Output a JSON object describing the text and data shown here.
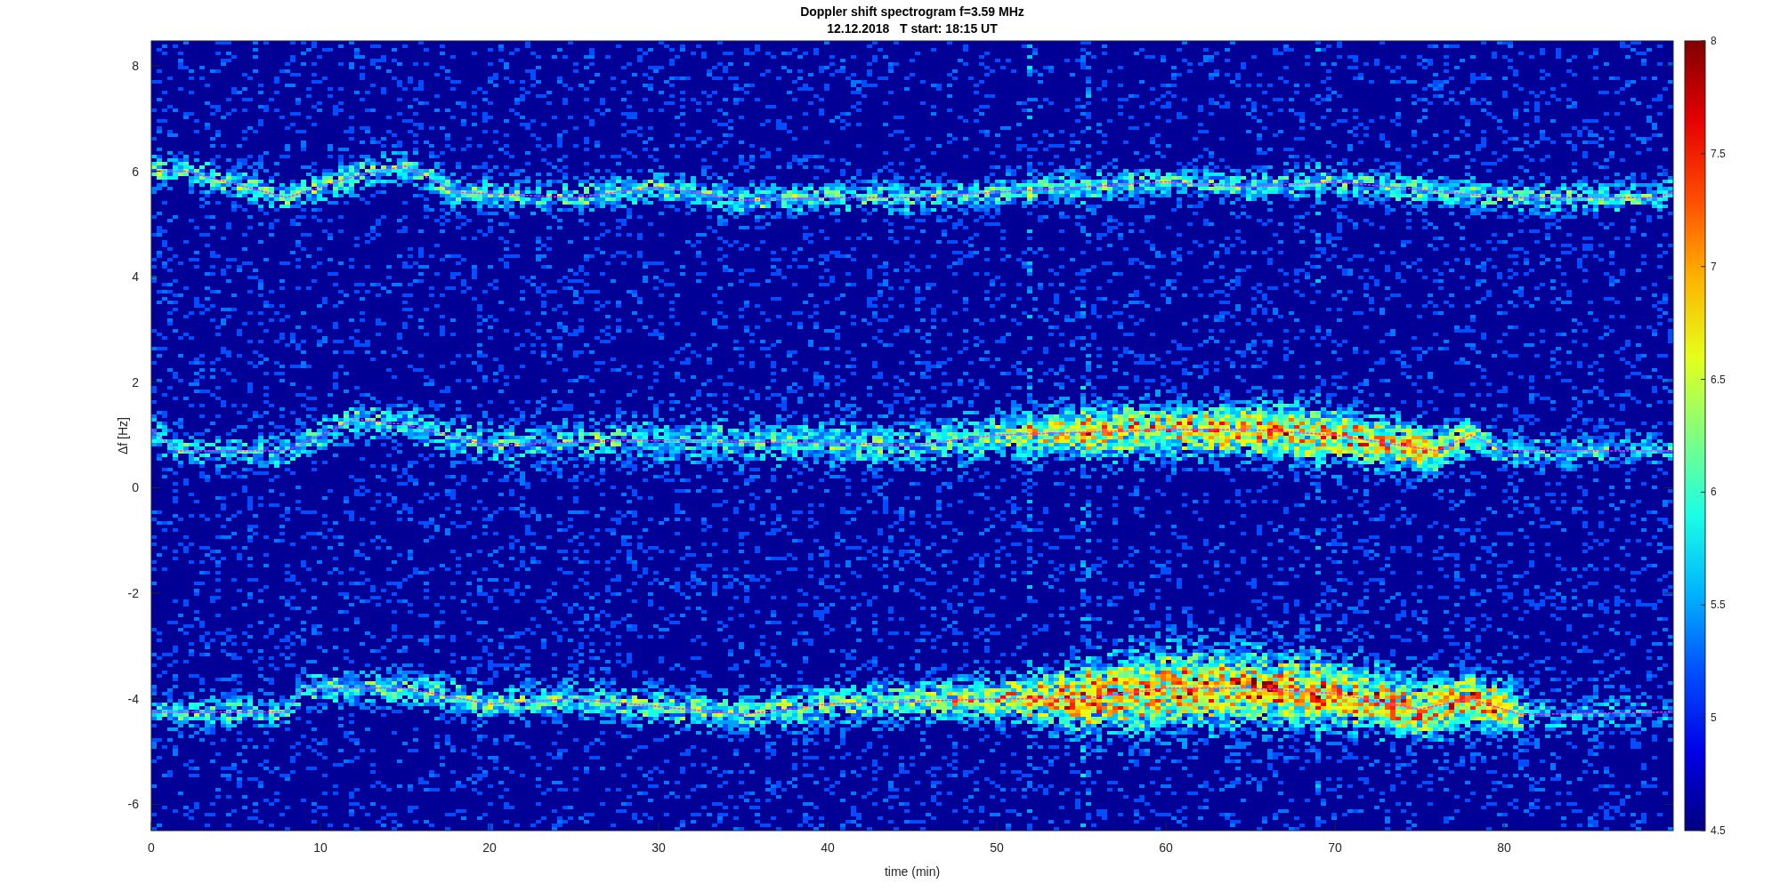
{
  "figure": {
    "title_lines": [
      "Doppler shift spectrogram f=3.59 MHz",
      "12.12.2018   T start: 18:15 UT"
    ],
    "y_axis": {
      "label": "Δf [Hz]",
      "ticks": [
        "8",
        "6",
        "4",
        "2",
        "0",
        "-2",
        "-4",
        "-6"
      ]
    },
    "x_axis": {
      "label": "time (min)",
      "ticks": [
        "0",
        "10",
        "20",
        "30",
        "40",
        "50",
        "60",
        "70",
        "80"
      ]
    },
    "colorbar": {
      "ticks": [
        "8",
        "7.5",
        "7",
        "6.5",
        "6",
        "5.5",
        "5",
        "4.5"
      ]
    }
  }
}
